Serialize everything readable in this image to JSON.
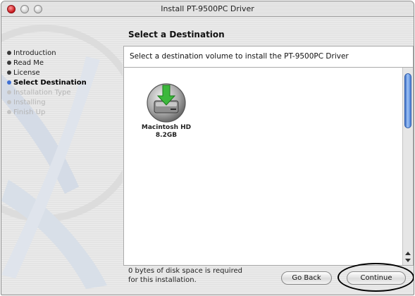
{
  "window": {
    "title": "Install PT-9500PC Driver"
  },
  "steps": [
    {
      "label": "Introduction",
      "state": "done"
    },
    {
      "label": "Read Me",
      "state": "done"
    },
    {
      "label": "License",
      "state": "done"
    },
    {
      "label": "Select Destination",
      "state": "current"
    },
    {
      "label": "Installation Type",
      "state": "pending"
    },
    {
      "label": "Installing",
      "state": "pending"
    },
    {
      "label": "Finish Up",
      "state": "pending"
    }
  ],
  "main": {
    "heading": "Select a Destination",
    "instruction": "Select a destination volume to install the PT-9500PC Driver",
    "volumes": [
      {
        "name": "Macintosh HD",
        "size": "8.2GB",
        "icon": "hard-drive-icon"
      }
    ],
    "space_note_line1": "0 bytes of disk space is required",
    "space_note_line2": "for this installation."
  },
  "buttons": {
    "go_back": "Go Back",
    "continue": "Continue"
  },
  "colors": {
    "current_step": "#3f6fd3",
    "scroll_thumb": "#5b8fe0",
    "download_arrow": "#3cb83c"
  }
}
